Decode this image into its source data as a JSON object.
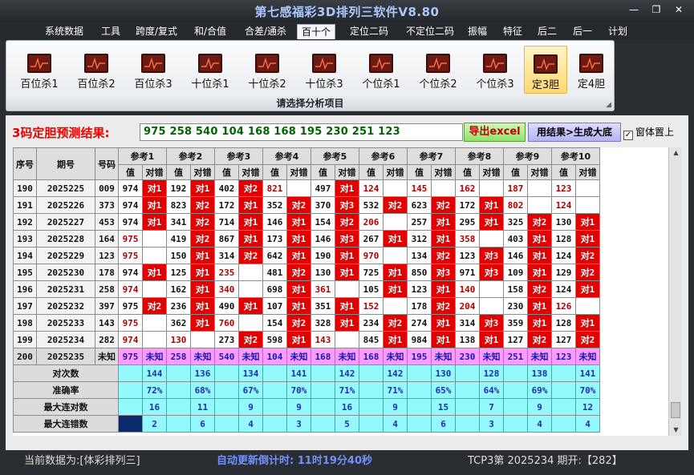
{
  "window": {
    "title": "第七感福彩3D排列三软件V8.80",
    "min_icon": "minimize-icon",
    "max_icon": "restore-icon",
    "close_icon": "close-icon"
  },
  "menu": [
    "系统数据",
    "工具",
    "跨度/复式",
    "和/合值",
    "合差/通杀",
    "百十个",
    "定位二码",
    "不定位二码",
    "振幅",
    "特征",
    "后二",
    "后一",
    "计划"
  ],
  "menu_active": "百十个",
  "ribbon": {
    "buttons": [
      "百位杀1",
      "百位杀2",
      "百位杀3",
      "十位杀1",
      "十位杀2",
      "十位杀3",
      "个位杀1",
      "个位杀2",
      "个位杀3",
      "定3胆",
      "定4胆"
    ],
    "selected": "定3胆",
    "footer": "请选择分析项目",
    "icon": "chart-icon"
  },
  "result": {
    "label": "3码定胆预测结果:",
    "value": "975 258 540 104 168 168 195 230 251 123",
    "export_label": "导出excel",
    "gen_label": "用结果>生成大底",
    "topmost_label": "窗体置上",
    "topmost_checked": "✓"
  },
  "table": {
    "fixed_headers": [
      "序号",
      "期号",
      "号码"
    ],
    "refs": [
      "参考1",
      "参考2",
      "参考3",
      "参考4",
      "参考5",
      "参考6",
      "参考7",
      "参考8",
      "参考9",
      "参考10"
    ],
    "sub_headers": [
      "值",
      "对错"
    ],
    "rows": [
      {
        "seq": "190",
        "issue": "2025225",
        "num": "009",
        "cells": [
          [
            "974",
            "对1"
          ],
          [
            "192",
            "对1"
          ],
          [
            "402",
            "对2"
          ],
          [
            "821",
            ""
          ],
          [
            "497",
            "对1"
          ],
          [
            "124",
            ""
          ],
          [
            "145",
            ""
          ],
          [
            "162",
            ""
          ],
          [
            "187",
            ""
          ],
          [
            "123",
            ""
          ]
        ]
      },
      {
        "seq": "191",
        "issue": "2025226",
        "num": "373",
        "cells": [
          [
            "974",
            "对1"
          ],
          [
            "823",
            "对2"
          ],
          [
            "172",
            "对1"
          ],
          [
            "352",
            "对2"
          ],
          [
            "370",
            "对3"
          ],
          [
            "532",
            "对2"
          ],
          [
            "623",
            "对2"
          ],
          [
            "172",
            "对1"
          ],
          [
            "802",
            ""
          ],
          [
            "124",
            ""
          ]
        ]
      },
      {
        "seq": "192",
        "issue": "2025227",
        "num": "453",
        "cells": [
          [
            "974",
            "对1"
          ],
          [
            "341",
            "对2"
          ],
          [
            "714",
            "对1"
          ],
          [
            "146",
            "对1"
          ],
          [
            "154",
            "对2"
          ],
          [
            "206",
            ""
          ],
          [
            "257",
            "对1"
          ],
          [
            "295",
            "对1"
          ],
          [
            "325",
            "对2"
          ],
          [
            "130",
            "对1"
          ]
        ]
      },
      {
        "seq": "193",
        "issue": "2025228",
        "num": "164",
        "cells": [
          [
            "975",
            ""
          ],
          [
            "419",
            "对2"
          ],
          [
            "867",
            "对1"
          ],
          [
            "173",
            "对1"
          ],
          [
            "146",
            "对3"
          ],
          [
            "267",
            "对1"
          ],
          [
            "312",
            "对1"
          ],
          [
            "358",
            ""
          ],
          [
            "403",
            "对1"
          ],
          [
            "128",
            "对1"
          ]
        ]
      },
      {
        "seq": "194",
        "issue": "2025229",
        "num": "123",
        "cells": [
          [
            "975",
            ""
          ],
          [
            "150",
            "对1"
          ],
          [
            "314",
            "对2"
          ],
          [
            "642",
            "对1"
          ],
          [
            "190",
            "对1"
          ],
          [
            "970",
            ""
          ],
          [
            "134",
            "对2"
          ],
          [
            "123",
            "对3"
          ],
          [
            "146",
            "对1"
          ],
          [
            "124",
            "对2"
          ]
        ]
      },
      {
        "seq": "195",
        "issue": "2025230",
        "num": "178",
        "cells": [
          [
            "974",
            "对1"
          ],
          [
            "125",
            "对1"
          ],
          [
            "235",
            ""
          ],
          [
            "481",
            "对2"
          ],
          [
            "130",
            "对1"
          ],
          [
            "725",
            "对1"
          ],
          [
            "850",
            "对3"
          ],
          [
            "971",
            "对3"
          ],
          [
            "109",
            "对1"
          ],
          [
            "129",
            "对2"
          ]
        ]
      },
      {
        "seq": "196",
        "issue": "2025231",
        "num": "258",
        "cells": [
          [
            "974",
            ""
          ],
          [
            "162",
            "对1"
          ],
          [
            "340",
            ""
          ],
          [
            "698",
            "对1"
          ],
          [
            "361",
            ""
          ],
          [
            "105",
            "对1"
          ],
          [
            "123",
            "对1"
          ],
          [
            "140",
            ""
          ],
          [
            "158",
            "对2"
          ],
          [
            "124",
            "对1"
          ]
        ]
      },
      {
        "seq": "197",
        "issue": "2025232",
        "num": "397",
        "cells": [
          [
            "975",
            "对2"
          ],
          [
            "236",
            "对1"
          ],
          [
            "490",
            "对1"
          ],
          [
            "107",
            "对1"
          ],
          [
            "351",
            "对1"
          ],
          [
            "152",
            ""
          ],
          [
            "178",
            "对2"
          ],
          [
            "204",
            ""
          ],
          [
            "230",
            "对1"
          ],
          [
            "126",
            ""
          ]
        ]
      },
      {
        "seq": "198",
        "issue": "2025233",
        "num": "143",
        "cells": [
          [
            "975",
            ""
          ],
          [
            "362",
            "对1"
          ],
          [
            "760",
            ""
          ],
          [
            "154",
            "对2"
          ],
          [
            "328",
            "对1"
          ],
          [
            "234",
            "对2"
          ],
          [
            "274",
            "对1"
          ],
          [
            "314",
            "对3"
          ],
          [
            "359",
            "对1"
          ],
          [
            "128",
            "对1"
          ]
        ]
      },
      {
        "seq": "199",
        "issue": "2025234",
        "num": "282",
        "cells": [
          [
            "974",
            ""
          ],
          [
            "130",
            ""
          ],
          [
            "273",
            "对2"
          ],
          [
            "598",
            "对1"
          ],
          [
            "143",
            ""
          ],
          [
            "845",
            "对1"
          ],
          [
            "984",
            "对1"
          ],
          [
            "138",
            "对1"
          ],
          [
            "127",
            "对2"
          ],
          [
            "127",
            "对2"
          ]
        ]
      }
    ],
    "pred_row": {
      "seq": "200",
      "issue": "2025235",
      "num": "未知",
      "values": [
        "975",
        "258",
        "540",
        "104",
        "168",
        "168",
        "195",
        "230",
        "251",
        "123"
      ],
      "mark": "未知"
    },
    "stats": [
      {
        "label": "对次数",
        "values": [
          "144",
          "136",
          "134",
          "141",
          "142",
          "142",
          "130",
          "128",
          "138",
          "141"
        ]
      },
      {
        "label": "准确率",
        "values": [
          "72%",
          "68%",
          "67%",
          "70%",
          "71%",
          "71%",
          "65%",
          "64%",
          "69%",
          "70%"
        ]
      },
      {
        "label": "最大连对数",
        "values": [
          "16",
          "11",
          "9",
          "9",
          "16",
          "9",
          "15",
          "7",
          "9",
          "12"
        ]
      },
      {
        "label": "最大连错数",
        "values": [
          "2",
          "6",
          "4",
          "3",
          "5",
          "4",
          "6",
          "3",
          "4",
          "4"
        ]
      }
    ]
  },
  "status": {
    "data_source": "当前数据为:[体彩排列三]",
    "countdown": "自动更新倒计时: 11时19分40秒",
    "draw": "TCP3第 2025234 期开:【282】"
  }
}
